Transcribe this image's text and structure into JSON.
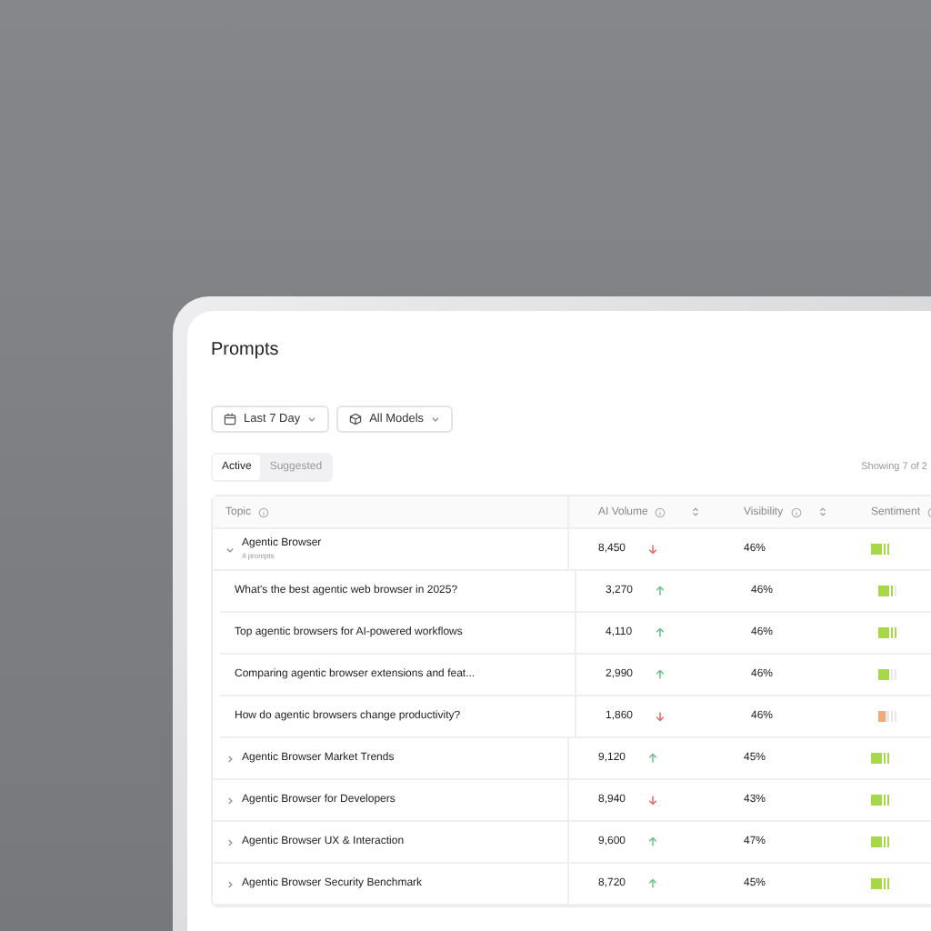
{
  "title": "Prompts",
  "filters": [
    {
      "kind": "date",
      "label": "Last 7 Day"
    },
    {
      "kind": "model",
      "label": "All Models"
    }
  ],
  "tabs": [
    {
      "label": "Active",
      "selected": true
    },
    {
      "label": "Suggested",
      "selected": false
    }
  ],
  "showing": "Showing 7 of 2",
  "columns": [
    {
      "label": "Topic",
      "info": true,
      "sortable": false
    },
    {
      "label": "AI Volume",
      "info": true,
      "sortable": true
    },
    {
      "label": "Visibility",
      "info": true,
      "sortable": true
    },
    {
      "label": "Sentiment",
      "info": true
    }
  ],
  "rows": [
    {
      "topic": "Agentic Browser",
      "subtitle": "4 prompts",
      "expanded": true,
      "volume": "8,450",
      "rising": false,
      "visibility": "46%",
      "sentiment": {
        "level": 1,
        "color": "#a6d84a"
      },
      "children": [
        {
          "topic": "What's the best agentic web browser in 2025?",
          "volume": "3,270",
          "rising": true,
          "visibility": "46%",
          "sentiment": {
            "level": 0.8,
            "color": "#a6d84a"
          }
        },
        {
          "topic": "Top agentic browsers for AI-powered workflows",
          "volume": "4,110",
          "rising": true,
          "visibility": "46%",
          "sentiment": {
            "level": 1,
            "color": "#a6d84a"
          }
        },
        {
          "topic": "Comparing agentic browser extensions and feat...",
          "volume": "2,990",
          "rising": true,
          "visibility": "46%",
          "sentiment": {
            "level": 0.6,
            "color": "#a6d84a"
          }
        },
        {
          "topic": "How do agentic browsers change productivity?",
          "volume": "1,860",
          "rising": false,
          "visibility": "46%",
          "sentiment": {
            "level": 0.4,
            "color": "#eeab7e"
          }
        }
      ]
    },
    {
      "topic": "Agentic Browser Market Trends",
      "expanded": false,
      "volume": "9,120",
      "rising": true,
      "visibility": "45%",
      "sentiment": {
        "level": 1,
        "color": "#a6d84a"
      }
    },
    {
      "topic": "Agentic Browser for Developers",
      "expanded": false,
      "volume": "8,940",
      "rising": false,
      "visibility": "43%",
      "sentiment": {
        "level": 1,
        "color": "#a6d84a"
      }
    },
    {
      "topic": "Agentic Browser UX & Interaction",
      "expanded": false,
      "volume": "9,600",
      "rising": true,
      "visibility": "47%",
      "sentiment": {
        "level": 1,
        "color": "#a6d84a"
      }
    },
    {
      "topic": "Agentic Browser Security Benchmark",
      "expanded": false,
      "volume": "8,720",
      "rising": true,
      "visibility": "45%",
      "sentiment": {
        "level": 1,
        "color": "#a6d84a"
      }
    }
  ]
}
